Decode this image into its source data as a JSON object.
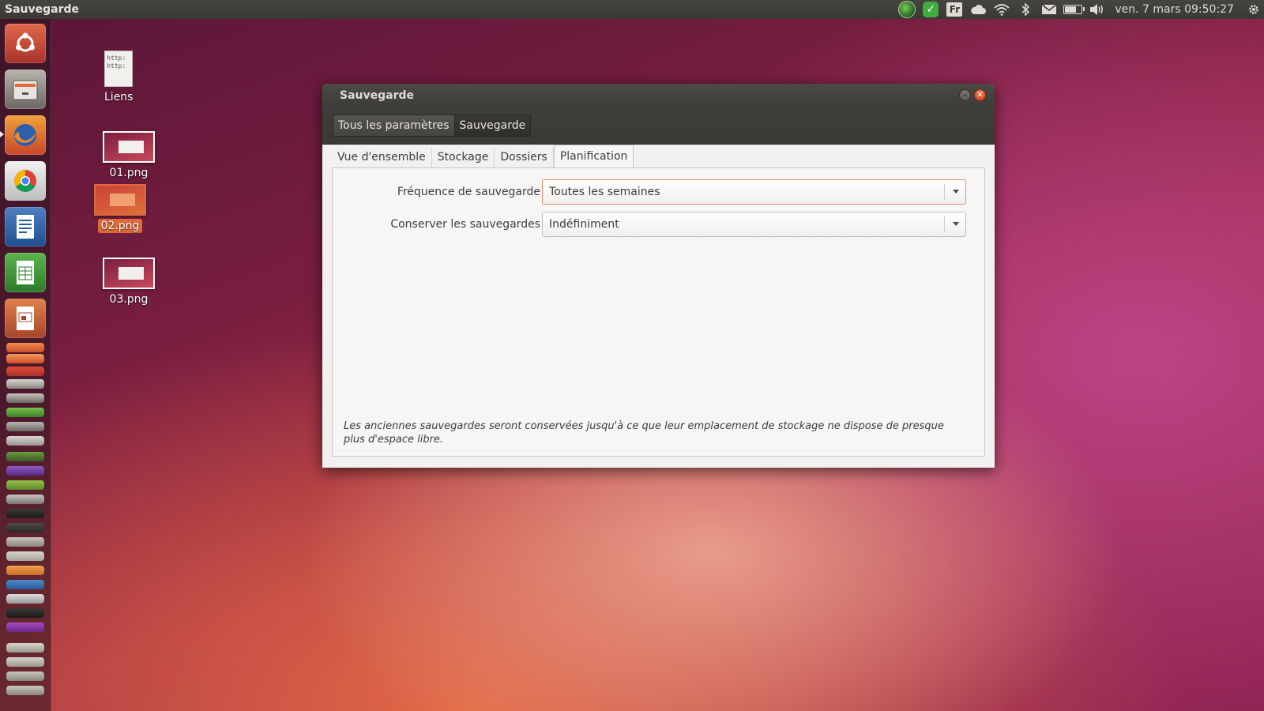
{
  "top_panel": {
    "app_title": "Sauvegarde",
    "keyboard_layout": "Fr",
    "clock": "ven. 7 mars  09:50:27",
    "battery_level": 0.75,
    "icons": [
      "globe-icon",
      "check-icon",
      "keyboard-layout-icon",
      "cloud-icon",
      "wifi-icon",
      "bluetooth-icon",
      "mail-icon",
      "battery-icon",
      "volume-icon",
      "gear-icon"
    ]
  },
  "desktop": {
    "icons": [
      {
        "label": "Liens",
        "doc_text": "http:\nhttp:"
      },
      {
        "label": "01.png"
      },
      {
        "label": "02.png"
      },
      {
        "label": "03.png"
      }
    ]
  },
  "launcher": {
    "items": [
      "ubuntu-icon",
      "files-icon",
      "firefox-icon",
      "chrome-icon",
      "writer-icon",
      "calc-icon",
      "impress-icon"
    ]
  },
  "window": {
    "title": "Sauvegarde",
    "breadcrumbs": [
      "Tous les paramètres",
      "Sauvegarde"
    ],
    "tabs": [
      "Vue d'ensemble",
      "Stockage",
      "Dossiers",
      "Planification"
    ],
    "active_tab": "Planification",
    "schedule": {
      "frequency_label": "Fréquence de sauvegarde",
      "frequency_value": "Toutes les semaines",
      "keep_label": "Conserver les sauvegardes",
      "keep_value": "Indéfiniment"
    },
    "note": "Les anciennes sauvegardes seront conservées jusqu'à ce que leur emplacement de stockage ne dispose de presque plus d'espace libre."
  },
  "colors": {
    "accent": "#e06a3a",
    "panel": "#3a3935"
  }
}
